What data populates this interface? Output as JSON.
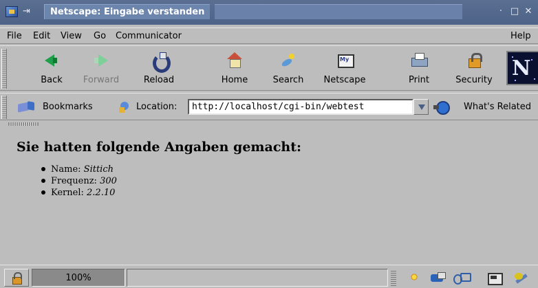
{
  "window": {
    "title": "Netscape: Eingabe verstanden",
    "controls": {
      "minimize": "·",
      "maximize": "□",
      "close": "✕"
    },
    "sticky_glyph": "⇥"
  },
  "menubar": {
    "items": [
      "File",
      "Edit",
      "View",
      "Go",
      "Communicator",
      "Help"
    ]
  },
  "toolbar": {
    "buttons": [
      {
        "label": "Back",
        "icon": "back-arrow-icon"
      },
      {
        "label": "Forward",
        "icon": "forward-arrow-icon",
        "disabled": true
      },
      {
        "label": "Reload",
        "icon": "reload-icon"
      },
      {
        "label": "Home",
        "icon": "home-icon"
      },
      {
        "label": "Search",
        "icon": "search-icon"
      },
      {
        "label": "Netscape",
        "icon": "my-netscape-icon"
      },
      {
        "label": "Print",
        "icon": "printer-icon"
      },
      {
        "label": "Security",
        "icon": "padlock-icon"
      }
    ],
    "throbber_letter": "N"
  },
  "location_bar": {
    "bookmarks_label": "Bookmarks",
    "location_label": "Location:",
    "url": "http://localhost/cgi-bin/webtest",
    "whats_related_label": "What's Related"
  },
  "content": {
    "heading": "Sie hatten folgende Angaben gemacht:",
    "items": [
      {
        "label": "Name:",
        "value": "Sittich"
      },
      {
        "label": "Frequenz:",
        "value": "300"
      },
      {
        "label": "Kernel:",
        "value": "2.2.10"
      }
    ]
  },
  "statusbar": {
    "progress_label": "100%",
    "progress_fraction": 1.0,
    "status_text": ""
  },
  "colors": {
    "titlebar": "#5a6f92",
    "background": "#bdbdbd",
    "accent": "#4a5f86"
  }
}
